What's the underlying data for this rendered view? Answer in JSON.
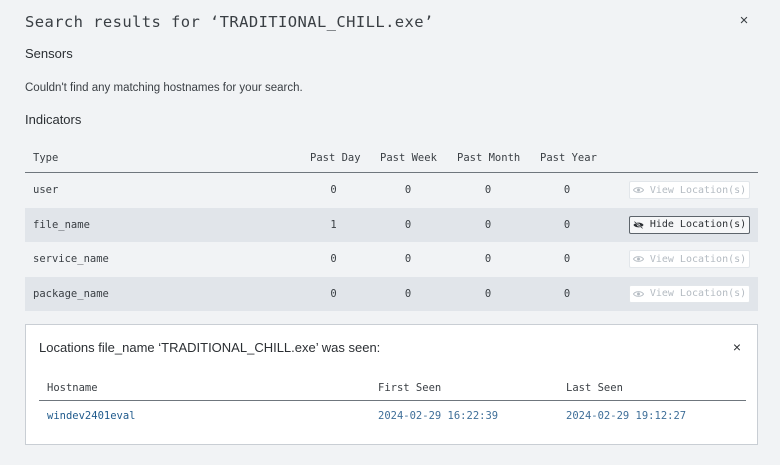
{
  "header": {
    "title": "Search results for ‘TRADITIONAL_CHILL.exe’",
    "close_symbol": "×"
  },
  "sensors": {
    "heading": "Sensors",
    "message": "Couldn't find any matching hostnames for your search."
  },
  "indicators": {
    "heading": "Indicators",
    "columns": [
      "Type",
      "Past Day",
      "Past Week",
      "Past Month",
      "Past Year"
    ],
    "rows": [
      {
        "type": "user",
        "day": "0",
        "week": "0",
        "month": "0",
        "year": "0",
        "action": "View Location(s)",
        "action_icon": "eye-icon"
      },
      {
        "type": "file_name",
        "day": "1",
        "week": "0",
        "month": "0",
        "year": "0",
        "action": "Hide Location(s)",
        "action_icon": "eye-slash-icon"
      },
      {
        "type": "service_name",
        "day": "0",
        "week": "0",
        "month": "0",
        "year": "0",
        "action": "View Location(s)",
        "action_icon": "eye-icon"
      },
      {
        "type": "package_name",
        "day": "0",
        "week": "0",
        "month": "0",
        "year": "0",
        "action": "View Location(s)",
        "action_icon": "eye-icon"
      }
    ]
  },
  "locations": {
    "title": "Locations file_name ‘TRADITIONAL_CHILL.exe’ was seen:",
    "close_symbol": "×",
    "columns": [
      "Hostname",
      "First Seen",
      "Last Seen"
    ],
    "rows": [
      {
        "hostname": "windev2401eval",
        "first_seen": "2024-02-29 16:22:39",
        "last_seen": "2024-02-29 19:12:27"
      }
    ]
  },
  "colors": {
    "background": "#f1f3f5",
    "row_shade": "#e1e5ea",
    "link": "#1f5a8c",
    "disabled_button_text": "#b4bbc2"
  }
}
